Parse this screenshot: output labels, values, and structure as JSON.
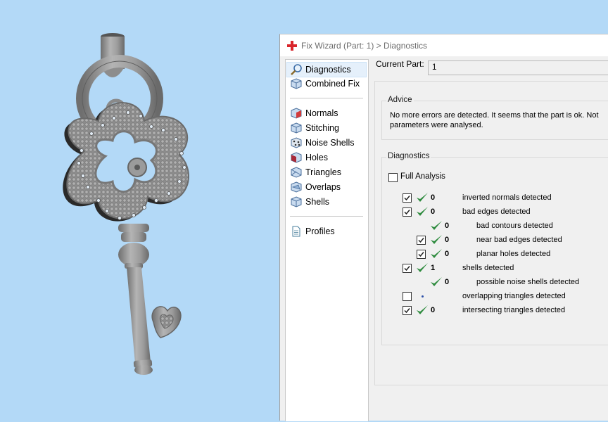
{
  "window": {
    "title": "Fix Wizard (Part: 1) > Diagnostics"
  },
  "nav": {
    "items": [
      {
        "label": "Diagnostics",
        "icon": "magnifier-icon",
        "selected": true
      },
      {
        "label": "Combined Fix",
        "icon": "cube-icon"
      },
      {
        "label": "Normals",
        "icon": "normals-cube-icon"
      },
      {
        "label": "Stitching",
        "icon": "stitching-cube-icon"
      },
      {
        "label": "Noise Shells",
        "icon": "noise-shells-icon"
      },
      {
        "label": "Holes",
        "icon": "holes-cube-icon"
      },
      {
        "label": "Triangles",
        "icon": "triangles-cube-icon"
      },
      {
        "label": "Overlaps",
        "icon": "overlaps-cube-icon"
      },
      {
        "label": "Shells",
        "icon": "shells-cube-icon"
      },
      {
        "label": "Profiles",
        "icon": "document-icon"
      }
    ]
  },
  "current_part": {
    "label": "Current Part:",
    "value": "1"
  },
  "advice": {
    "title": "Advice",
    "text": "No more errors are detected. It seems that the part is ok. Not parameters were analysed."
  },
  "diagnostics": {
    "title": "Diagnostics",
    "full_analysis": {
      "label": "Full Analysis",
      "checked": false
    },
    "rows": [
      {
        "label": "inverted normals detected",
        "count": "0",
        "checked": true,
        "status": "ok"
      },
      {
        "label": "bad edges detected",
        "count": "0",
        "checked": true,
        "status": "ok"
      },
      {
        "label": "bad contours detected",
        "count": "0",
        "checked": null,
        "status": "ok"
      },
      {
        "label": "near bad edges detected",
        "count": "0",
        "checked": true,
        "status": "ok"
      },
      {
        "label": "planar holes detected",
        "count": "0",
        "checked": true,
        "status": "ok"
      },
      {
        "label": "shells detected",
        "count": "1",
        "checked": true,
        "status": "ok"
      },
      {
        "label": "possible noise shells detected",
        "count": "0",
        "checked": null,
        "status": "ok"
      },
      {
        "label": "overlapping triangles detected",
        "count": "",
        "checked": false,
        "status": "not-analysed"
      },
      {
        "label": "intersecting triangles detected",
        "count": "0",
        "checked": true,
        "status": "ok"
      }
    ]
  },
  "colors": {
    "viewport_background": "#b3d9f7",
    "check_green": "#2e8b3e",
    "model_gray": "#9a9a9a"
  }
}
